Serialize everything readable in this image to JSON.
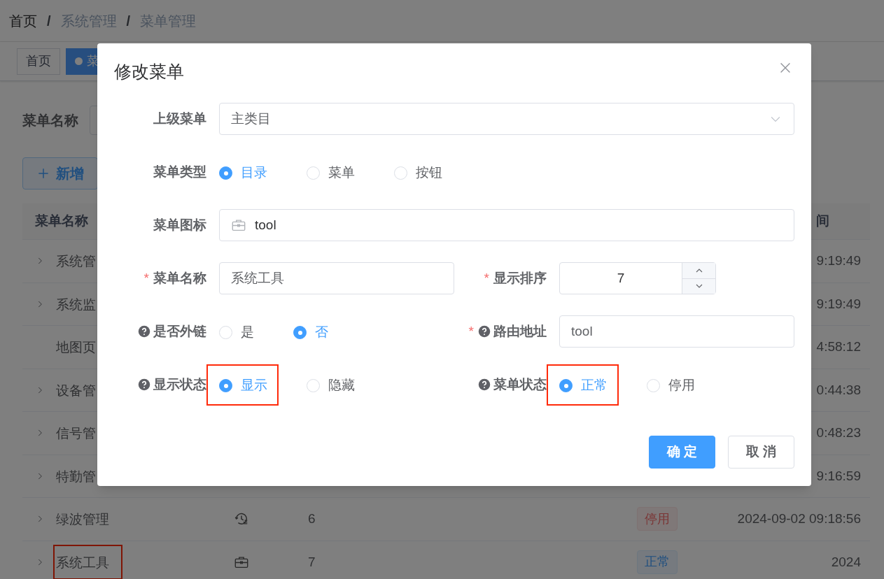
{
  "breadcrumb": {
    "separator": "/",
    "items": [
      {
        "label": "首页",
        "link": false
      },
      {
        "label": "系统管理",
        "link": true
      },
      {
        "label": "菜单管理",
        "link": true
      }
    ]
  },
  "tags_view": [
    {
      "label": "首页",
      "selected": false
    },
    {
      "label": "菜",
      "selected": true
    }
  ],
  "search": {
    "label": "菜单名称"
  },
  "add_button": {
    "label": "新增"
  },
  "table": {
    "header": {
      "name": "菜单名称",
      "column_6": "间"
    },
    "rows": [
      {
        "name": "系统管",
        "expandable": true,
        "annotated": false,
        "time": "9:19:49"
      },
      {
        "name": "系统监",
        "expandable": true,
        "annotated": false,
        "time": "9:19:49"
      },
      {
        "name": "地图页",
        "expandable": false,
        "annotated": false,
        "time": "4:58:12"
      },
      {
        "name": "设备管",
        "expandable": true,
        "annotated": false,
        "time": "0:44:38"
      },
      {
        "name": "信号管",
        "expandable": true,
        "annotated": false,
        "time": "0:48:23"
      },
      {
        "name": "特勤管",
        "expandable": true,
        "annotated": false,
        "time": "9:16:59"
      },
      {
        "name": "绿波管理",
        "expandable": true,
        "annotated": false,
        "order": "6",
        "status": {
          "label": "停用",
          "kind": "disabled"
        },
        "time": "2024-09-02 09:18:56"
      },
      {
        "name": "系统工具",
        "expandable": true,
        "annotated": true,
        "order": "7",
        "status": {
          "label": "正常",
          "kind": "normal"
        },
        "time": "2024"
      }
    ]
  },
  "dialog": {
    "title": "修改菜单",
    "required_mark": "*",
    "rows": [
      [
        {
          "kind": "select",
          "label": "上级菜单",
          "required": false,
          "help": false,
          "value": "主类目"
        }
      ],
      [
        {
          "kind": "radio",
          "label": "菜单类型",
          "required": false,
          "help": false,
          "options": [
            {
              "label": "目录",
              "selected": true,
              "annotated": false
            },
            {
              "label": "菜单",
              "selected": false,
              "annotated": false
            },
            {
              "label": "按钮",
              "selected": false,
              "annotated": false
            }
          ]
        }
      ],
      [
        {
          "kind": "icon_input",
          "label": "菜单图标",
          "required": false,
          "help": false,
          "value": "tool"
        }
      ],
      [
        {
          "kind": "text",
          "label": "菜单名称",
          "required": true,
          "help": false,
          "value": "系统工具"
        },
        {
          "kind": "number",
          "label": "显示排序",
          "required": true,
          "help": false,
          "value": "7"
        }
      ],
      [
        {
          "kind": "radio",
          "label": "是否外链",
          "required": false,
          "help": true,
          "options": [
            {
              "label": "是",
              "selected": false,
              "annotated": false
            },
            {
              "label": "否",
              "selected": true,
              "annotated": false
            }
          ]
        },
        {
          "kind": "text",
          "label": "路由地址",
          "required": true,
          "help": true,
          "value": "tool"
        }
      ],
      [
        {
          "kind": "radio",
          "label": "显示状态",
          "required": false,
          "help": true,
          "options": [
            {
              "label": "显示",
              "selected": true,
              "annotated": true
            },
            {
              "label": "隐藏",
              "selected": false,
              "annotated": false
            }
          ]
        },
        {
          "kind": "radio",
          "label": "菜单状态",
          "required": false,
          "help": true,
          "options": [
            {
              "label": "正常",
              "selected": true,
              "annotated": true
            },
            {
              "label": "停用",
              "selected": false,
              "annotated": false
            }
          ]
        }
      ]
    ],
    "buttons": [
      {
        "label": "确 定",
        "kind": "primary"
      },
      {
        "label": "取 消",
        "kind": "default"
      }
    ]
  }
}
